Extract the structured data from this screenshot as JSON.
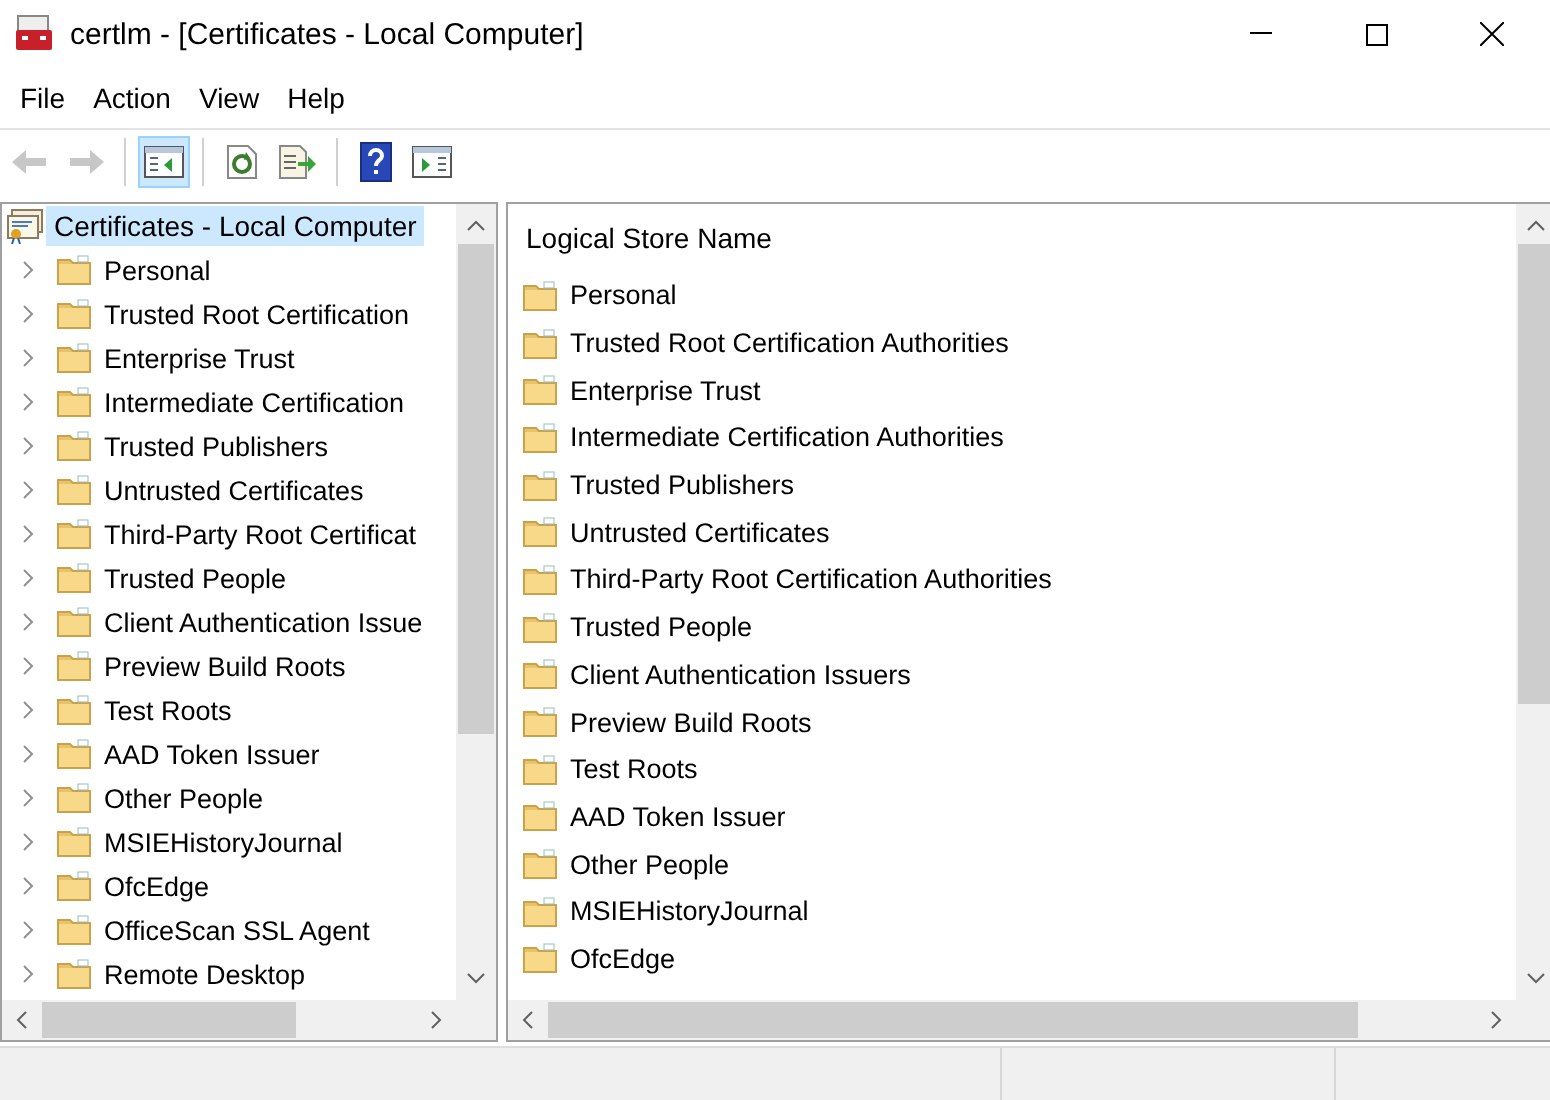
{
  "window": {
    "title": "certlm - [Certificates - Local Computer]"
  },
  "menu": [
    "File",
    "Action",
    "View",
    "Help"
  ],
  "toolbar": [
    {
      "kind": "back",
      "disabled": true,
      "selected": false
    },
    {
      "kind": "forward",
      "disabled": true,
      "selected": false
    },
    {
      "kind": "separator"
    },
    {
      "kind": "tree",
      "disabled": false,
      "selected": true
    },
    {
      "kind": "separator"
    },
    {
      "kind": "refresh",
      "disabled": false,
      "selected": false
    },
    {
      "kind": "export",
      "disabled": false,
      "selected": false
    },
    {
      "kind": "separator"
    },
    {
      "kind": "help",
      "disabled": false,
      "selected": false
    },
    {
      "kind": "action",
      "disabled": false,
      "selected": false
    }
  ],
  "tree": {
    "label": "Certificates - Local Computer",
    "selected": true,
    "children": [
      {
        "label": "Personal",
        "expanded": false
      },
      {
        "label": "Trusted Root Certification",
        "expanded": false
      },
      {
        "label": "Enterprise Trust",
        "expanded": false
      },
      {
        "label": "Intermediate Certification",
        "expanded": false
      },
      {
        "label": "Trusted Publishers",
        "expanded": false
      },
      {
        "label": "Untrusted Certificates",
        "expanded": false
      },
      {
        "label": "Third-Party Root Certificat",
        "expanded": false
      },
      {
        "label": "Trusted People",
        "expanded": false
      },
      {
        "label": "Client Authentication Issue",
        "expanded": false
      },
      {
        "label": "Preview Build Roots",
        "expanded": false
      },
      {
        "label": "Test Roots",
        "expanded": false
      },
      {
        "label": "AAD Token Issuer",
        "expanded": false
      },
      {
        "label": "Other People",
        "expanded": false
      },
      {
        "label": "MSIEHistoryJournal",
        "expanded": false
      },
      {
        "label": "OfcEdge",
        "expanded": false
      },
      {
        "label": "OfficeScan SSL Agent",
        "expanded": false
      },
      {
        "label": "Remote Desktop",
        "expanded": false
      }
    ]
  },
  "list": {
    "columns": [
      "Logical Store Name"
    ],
    "rows": [
      "Personal",
      "Trusted Root Certification Authorities",
      "Enterprise Trust",
      "Intermediate Certification Authorities",
      "Trusted Publishers",
      "Untrusted Certificates",
      "Third-Party Root Certification Authorities",
      "Trusted People",
      "Client Authentication Issuers",
      "Preview Build Roots",
      "Test Roots",
      "AAD Token Issuer",
      "Other People",
      "MSIEHistoryJournal",
      "OfcEdge"
    ]
  }
}
